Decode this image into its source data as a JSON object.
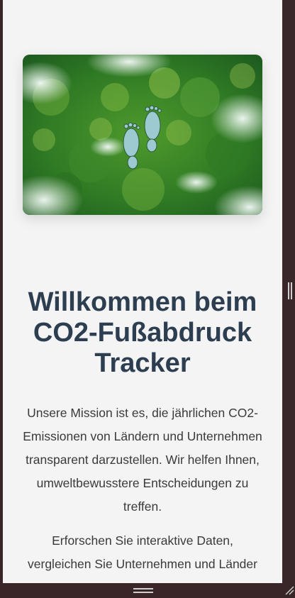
{
  "hero": {
    "image_name": "forest-footprint-image"
  },
  "welcome": {
    "title": "Willkommen beim CO2-Fußabdruck Tracker",
    "paragraph1": "Unsere Mission ist es, die jährlichen CO2-Emissionen von Ländern und Unternehmen transparent darzustellen. Wir helfen Ihnen, umweltbewusstere Entscheidungen zu treffen.",
    "paragraph2": "Erforschen Sie interaktive Daten, vergleichen Sie Unternehmen und Länder"
  },
  "colors": {
    "page_background": "#f4f4f5",
    "heading": "#2c3e50",
    "frame": "#3a2628"
  }
}
